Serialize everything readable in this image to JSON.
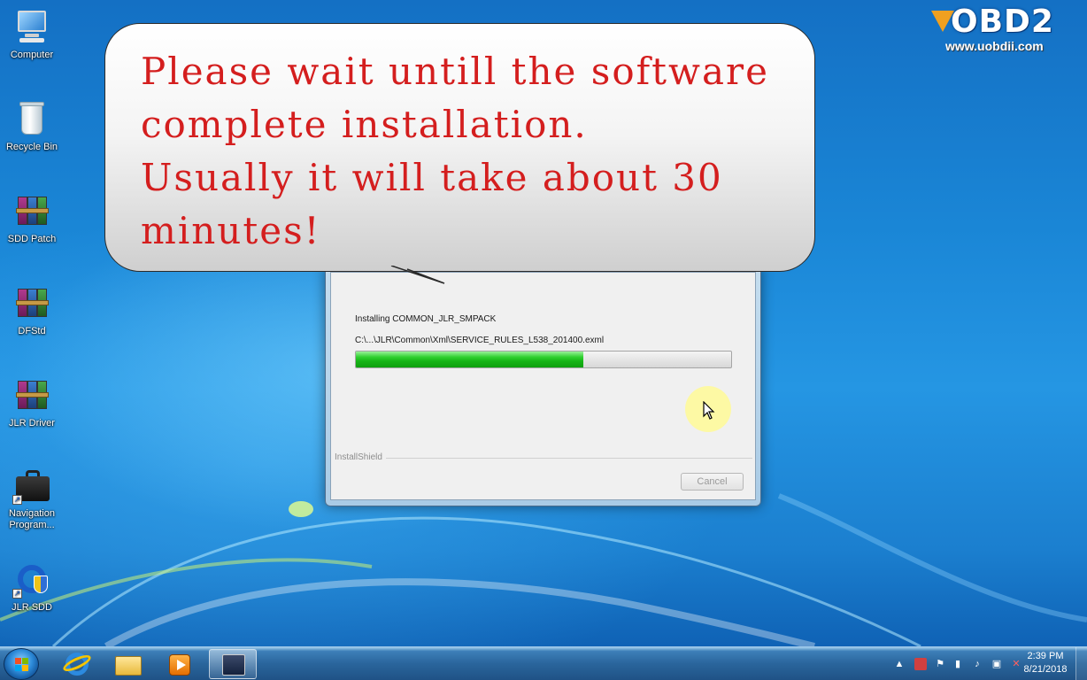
{
  "watermark": {
    "brand": "OBD2",
    "url": "www.uobdii.com"
  },
  "desktop_icons": [
    {
      "label": "Computer",
      "icon": "computer-icon"
    },
    {
      "label": "Recycle Bin",
      "icon": "recycle-bin-icon"
    },
    {
      "label": "SDD Patch",
      "icon": "winrar-archive-icon"
    },
    {
      "label": "DFStd",
      "icon": "winrar-archive-icon"
    },
    {
      "label": "JLR Driver",
      "icon": "winrar-archive-icon"
    },
    {
      "label": "Navigation Program...",
      "icon": "briefcase-icon"
    },
    {
      "label": "JLR SDD",
      "icon": "jlr-sdd-icon"
    }
  ],
  "callout": {
    "lines": [
      "Please wait untill the software",
      "complete installation.",
      "Usually it will take about 30",
      "minutes!"
    ],
    "text_color": "#d41e1e"
  },
  "installer": {
    "status": "Installing COMMON_JLR_SMPACK",
    "file_path": "C:\\...\\JLR\\Common\\Xml\\SERVICE_RULES_L538_201400.exml",
    "progress_fraction": 0.605,
    "brand_label": "InstallShield",
    "cancel_label": "Cancel",
    "progress_color": "#17b517"
  },
  "taskbar": {
    "pinned": [
      "start-orb",
      "internet-explorer-icon",
      "windows-explorer-icon",
      "media-player-icon",
      "installshield-icon"
    ],
    "tray_icons": [
      "show-hidden-icons-arrow",
      "action-center-icon",
      "security-flag-icon",
      "power-icon",
      "volume-icon",
      "network-icon",
      "usb-error-icon"
    ],
    "time": "2:39 PM",
    "date": "8/21/2018"
  }
}
